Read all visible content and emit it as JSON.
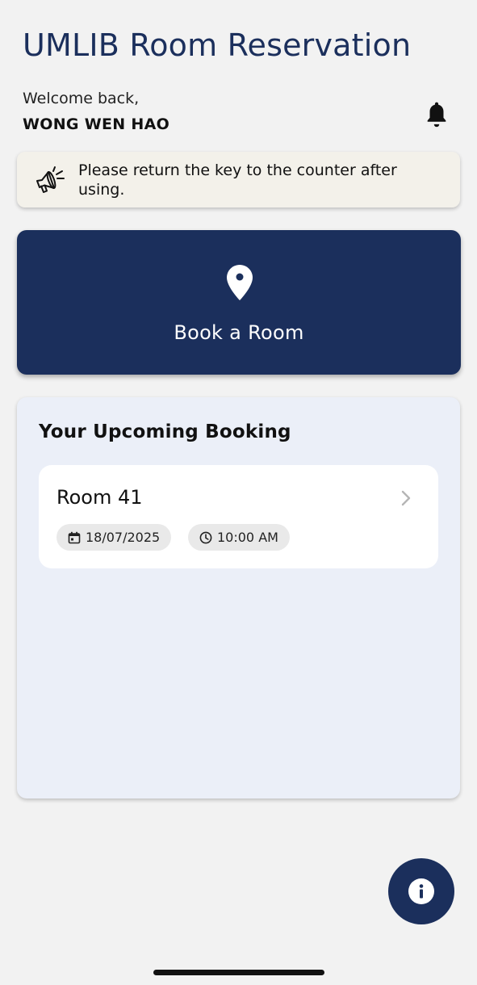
{
  "header": {
    "title": "UMLIB Room Reservation",
    "welcome": "Welcome back,",
    "user_name": "WONG WEN HAO"
  },
  "icons": {
    "notification": "bell-icon",
    "announcement": "megaphone-icon",
    "book": "location-pin-icon",
    "date": "calendar-icon",
    "time": "clock-icon",
    "open": "chevron-right-icon",
    "info": "info-icon"
  },
  "notice": {
    "text": "Please return the key to the counter after using."
  },
  "book_room": {
    "label": "Book a Room"
  },
  "upcoming": {
    "title": "Your Upcoming Booking",
    "bookings": [
      {
        "room": "Room 41",
        "date": "18/07/2025",
        "time": "10:00 AM"
      }
    ]
  },
  "colors": {
    "primary": "#1b2f5c",
    "background": "#f2f2f2",
    "panel": "#ebeff8",
    "notice_bg": "#f3f1ea"
  }
}
